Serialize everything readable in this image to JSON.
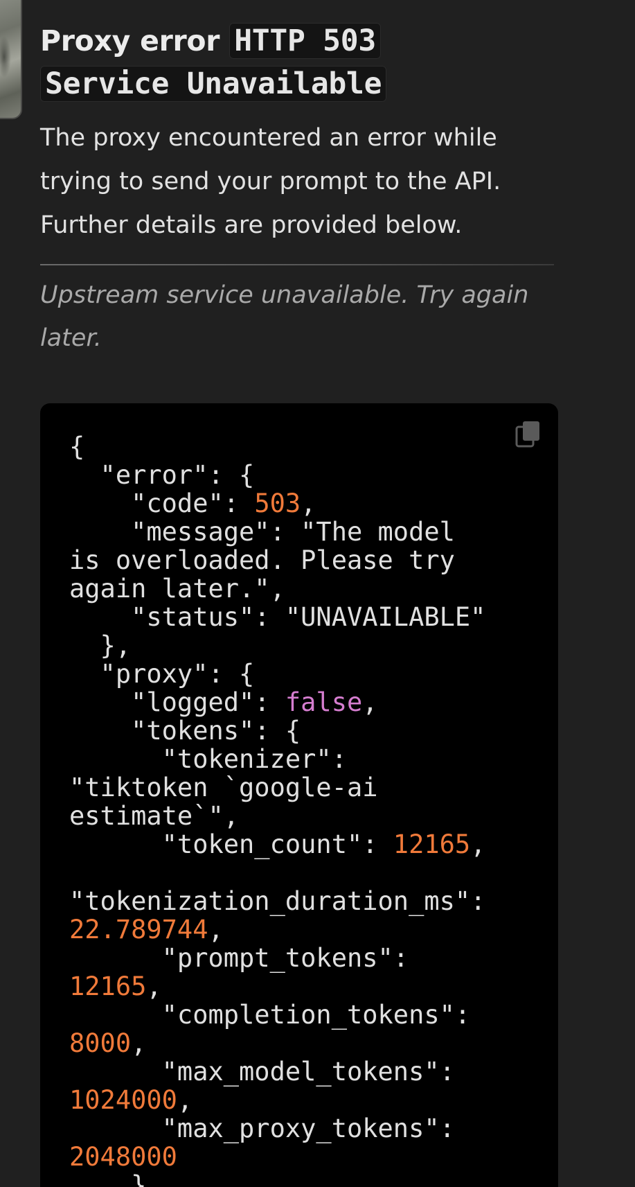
{
  "header": {
    "title_text": "Proxy error",
    "title_code_line1": "HTTP 503",
    "title_code_line2": "Service Unavailable"
  },
  "body": {
    "description_lines": [
      "The proxy encountered an error while",
      "trying to send your prompt to the API.",
      "Further details are provided below."
    ],
    "note_lines": [
      "Upstream service unavailable. Try again",
      "later."
    ]
  },
  "code_block": {
    "copy_icon": "copy-icon",
    "colors": {
      "number": "#f07a3a",
      "boolean": "#d57dcf",
      "text": "#e0e0e0"
    },
    "lines": [
      [
        {
          "t": "{"
        }
      ],
      [
        {
          "t": "  \"error\": {"
        }
      ],
      [
        {
          "t": "    \"code\": "
        },
        {
          "t": "503",
          "c": "num"
        },
        {
          "t": ","
        }
      ],
      [
        {
          "t": "    \"message\": \"The model"
        }
      ],
      [
        {
          "t": "is overloaded. Please try"
        }
      ],
      [
        {
          "t": "again later.\","
        }
      ],
      [
        {
          "t": "    \"status\": \"UNAVAILABLE\""
        }
      ],
      [
        {
          "t": "  },"
        }
      ],
      [
        {
          "t": "  \"proxy\": {"
        }
      ],
      [
        {
          "t": "    \"logged\": "
        },
        {
          "t": "false",
          "c": "bool"
        },
        {
          "t": ","
        }
      ],
      [
        {
          "t": "    \"tokens\": {"
        }
      ],
      [
        {
          "t": "      \"tokenizer\":"
        }
      ],
      [
        {
          "t": "\"tiktoken `google-ai"
        }
      ],
      [
        {
          "t": "estimate`\","
        }
      ],
      [
        {
          "t": "      \"token_count\": "
        },
        {
          "t": "12165",
          "c": "num"
        },
        {
          "t": ","
        }
      ],
      [
        {
          "t": ""
        }
      ],
      [
        {
          "t": "\"tokenization_duration_ms\":"
        }
      ],
      [
        {
          "t": "22.789744",
          "c": "num"
        },
        {
          "t": ","
        }
      ],
      [
        {
          "t": "      \"prompt_tokens\":"
        }
      ],
      [
        {
          "t": "12165",
          "c": "num"
        },
        {
          "t": ","
        }
      ],
      [
        {
          "t": "      \"completion_tokens\":"
        }
      ],
      [
        {
          "t": "8000",
          "c": "num"
        },
        {
          "t": ","
        }
      ],
      [
        {
          "t": "      \"max_model_tokens\":"
        }
      ],
      [
        {
          "t": "1024000",
          "c": "num"
        },
        {
          "t": ","
        }
      ],
      [
        {
          "t": "      \"max_proxy_tokens\":"
        }
      ],
      [
        {
          "t": "2048000",
          "c": "num"
        }
      ],
      [
        {
          "t": "    }"
        }
      ]
    ]
  }
}
